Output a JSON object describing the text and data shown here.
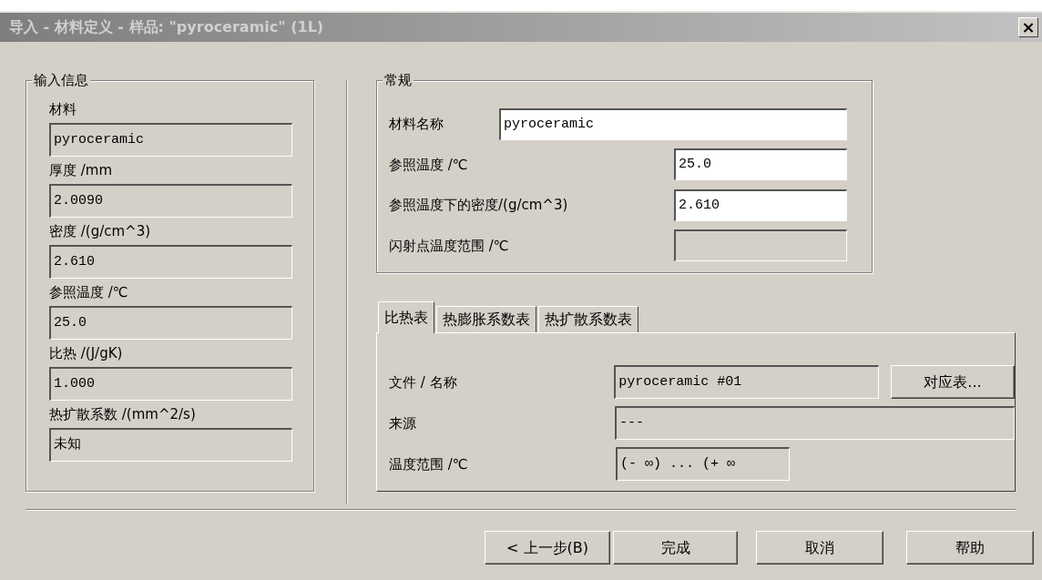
{
  "window": {
    "title": "导入 - 材料定义 - 样品: \"pyroceramic\" (1L)",
    "close": "×"
  },
  "input_info": {
    "legend": "输入信息",
    "fields": [
      {
        "label": "材料",
        "value": "pyroceramic"
      },
      {
        "label": "厚度 /mm",
        "value": "2.0090"
      },
      {
        "label": "密度 /(g/cm^3)",
        "value": "2.610"
      },
      {
        "label": "参照温度 /℃",
        "value": "25.0"
      },
      {
        "label": "比热 /(J/gK)",
        "value": "1.000"
      },
      {
        "label": "热扩散系数 /(mm^2/s)",
        "value": "未知"
      }
    ]
  },
  "general": {
    "legend": "常规",
    "fields": [
      {
        "label": "材料名称",
        "value": "pyroceramic",
        "disabled": false
      },
      {
        "label": "参照温度 /℃",
        "value": "25.0",
        "disabled": false
      },
      {
        "label": "参照温度下的密度/(g/cm^3)",
        "value": "2.610",
        "disabled": false
      },
      {
        "label": "闪射点温度范围 /℃",
        "disabled": true
      }
    ]
  },
  "tabs": [
    {
      "label": "比热表",
      "selected": true
    },
    {
      "label": "热膨胀系数表",
      "selected": false
    },
    {
      "label": "热扩散系数表",
      "selected": false
    }
  ],
  "tab_panel": {
    "rows": [
      {
        "label": "文件 / 名称",
        "value": "pyroceramic #01",
        "button": "对应表..."
      },
      {
        "label": "来源",
        "value": "---"
      },
      {
        "label": "温度范围 /℃",
        "value": "(- ∞) ... (+ ∞"
      }
    ]
  },
  "buttons": [
    "< 上一步(B)",
    "完成",
    "取消",
    "帮助"
  ]
}
